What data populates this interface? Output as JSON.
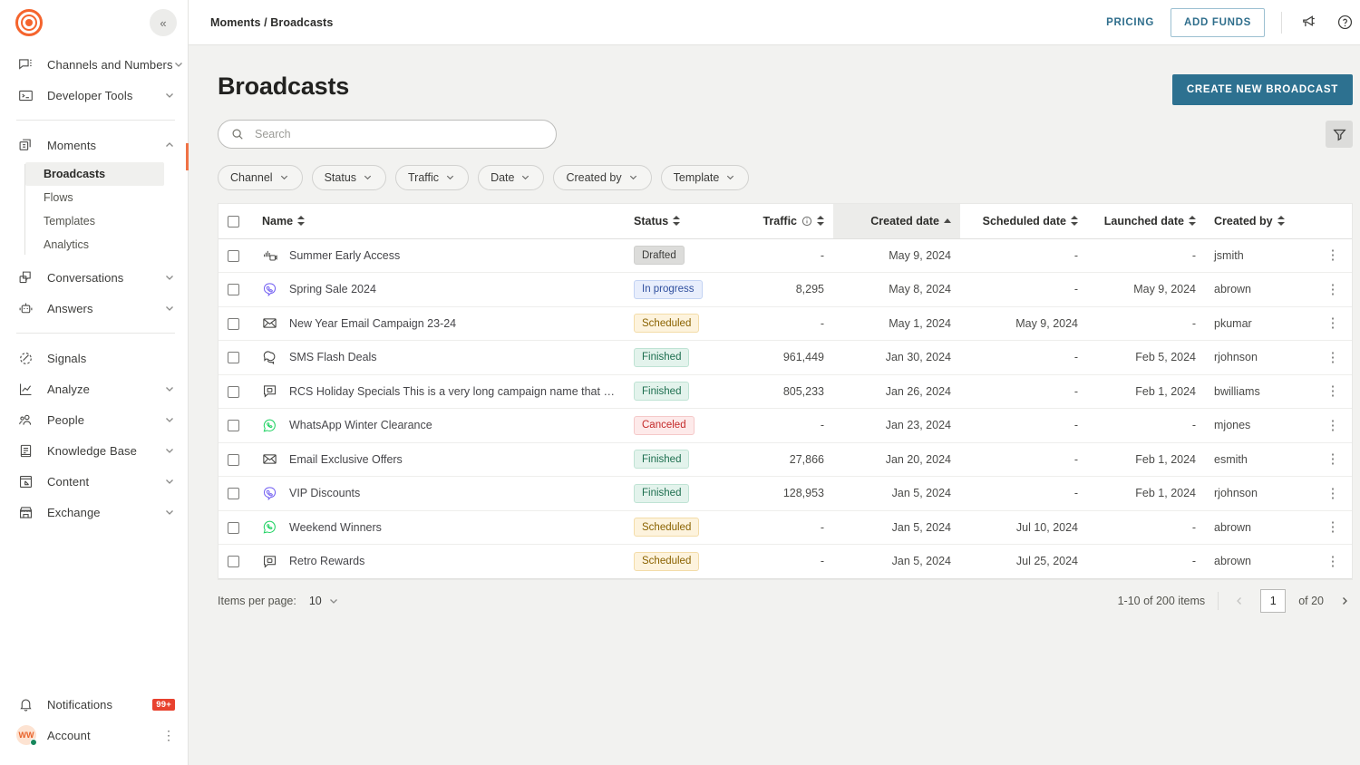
{
  "sidebar": {
    "logo_name": "infobip-logo-icon",
    "collapse_label": "«",
    "groups": [
      {
        "items": [
          {
            "label": "Channels and Numbers",
            "icon": "chat-numbers-icon",
            "expandable": true
          },
          {
            "label": "Developer Tools",
            "icon": "terminal-icon",
            "expandable": true
          }
        ]
      },
      {
        "items": [
          {
            "label": "Moments",
            "icon": "moments-icon",
            "expandable": true,
            "expanded": true,
            "children": [
              {
                "label": "Broadcasts",
                "active": true
              },
              {
                "label": "Flows",
                "active": false
              },
              {
                "label": "Templates",
                "active": false
              },
              {
                "label": "Analytics",
                "active": false
              }
            ]
          },
          {
            "label": "Conversations",
            "icon": "conversations-icon",
            "expandable": true
          },
          {
            "label": "Answers",
            "icon": "answers-bot-icon",
            "expandable": true
          }
        ]
      },
      {
        "items": [
          {
            "label": "Signals",
            "icon": "signals-icon",
            "expandable": false
          },
          {
            "label": "Analyze",
            "icon": "analyze-chart-icon",
            "expandable": true
          },
          {
            "label": "People",
            "icon": "people-icon",
            "expandable": true
          },
          {
            "label": "Knowledge Base",
            "icon": "knowledge-base-icon",
            "expandable": true
          },
          {
            "label": "Content",
            "icon": "content-icon",
            "expandable": true
          },
          {
            "label": "Exchange",
            "icon": "exchange-store-icon",
            "expandable": true
          }
        ]
      }
    ],
    "notifications": {
      "label": "Notifications",
      "badge": "99+",
      "icon": "bell-icon"
    },
    "account": {
      "label": "Account",
      "initials": "WW",
      "status": "online"
    }
  },
  "topbar": {
    "breadcrumb": "Moments / Broadcasts",
    "pricing_label": "PRICING",
    "add_funds_label": "ADD FUNDS",
    "announcements_icon": "megaphone-icon",
    "help_icon": "help-circle-icon"
  },
  "page": {
    "title": "Broadcasts",
    "create_button_label": "CREATE NEW BROADCAST"
  },
  "search": {
    "placeholder": "Search",
    "value": "",
    "icon": "search-icon"
  },
  "filter_button": {
    "icon": "funnel-filter-icon"
  },
  "filters": [
    {
      "label": "Channel"
    },
    {
      "label": "Status"
    },
    {
      "label": "Traffic"
    },
    {
      "label": "Date"
    },
    {
      "label": "Created by"
    },
    {
      "label": "Template"
    }
  ],
  "table": {
    "columns": [
      {
        "key": "name",
        "label": "Name",
        "sortable": true,
        "sorted": "none",
        "align": "left"
      },
      {
        "key": "status",
        "label": "Status",
        "sortable": true,
        "sorted": "none",
        "align": "left"
      },
      {
        "key": "traffic",
        "label": "Traffic",
        "sortable": true,
        "sorted": "none",
        "align": "right",
        "info": true
      },
      {
        "key": "created_date",
        "label": "Created date",
        "sortable": true,
        "sorted": "asc",
        "align": "right"
      },
      {
        "key": "scheduled_date",
        "label": "Scheduled date",
        "sortable": true,
        "sorted": "none",
        "align": "right"
      },
      {
        "key": "launched_date",
        "label": "Launched date",
        "sortable": true,
        "sorted": "none",
        "align": "right"
      },
      {
        "key": "created_by",
        "label": "Created by",
        "sortable": true,
        "sorted": "none",
        "align": "left"
      }
    ],
    "rows": [
      {
        "name": "Summer Early Access",
        "icon": "broadcast-multichannel-icon",
        "status": "Drafted",
        "status_kind": "drafted",
        "traffic": "-",
        "created_date": "May 9, 2024",
        "scheduled_date": "-",
        "launched_date": "-",
        "created_by": "jsmith"
      },
      {
        "name": "Spring Sale 2024",
        "icon": "viber-icon",
        "status": "In progress",
        "status_kind": "inprogress",
        "traffic": "8,295",
        "created_date": "May 8, 2024",
        "scheduled_date": "-",
        "launched_date": "May 9, 2024",
        "created_by": "abrown"
      },
      {
        "name": "New Year Email Campaign 23-24",
        "icon": "email-icon",
        "status": "Scheduled",
        "status_kind": "scheduled",
        "traffic": "-",
        "created_date": "May 1, 2024",
        "scheduled_date": "May 9, 2024",
        "launched_date": "-",
        "created_by": "pkumar"
      },
      {
        "name": "SMS Flash Deals",
        "icon": "sms-icon",
        "status": "Finished",
        "status_kind": "finished",
        "traffic": "961,449",
        "created_date": "Jan 30, 2024",
        "scheduled_date": "-",
        "launched_date": "Feb 5, 2024",
        "created_by": "rjohnson"
      },
      {
        "name": "RCS Holiday Specials This is a very long campaign name that wont fit into...",
        "icon": "rcs-icon",
        "status": "Finished",
        "status_kind": "finished",
        "traffic": "805,233",
        "created_date": "Jan 26, 2024",
        "scheduled_date": "-",
        "launched_date": "Feb 1, 2024",
        "created_by": "bwilliams"
      },
      {
        "name": "WhatsApp Winter Clearance",
        "icon": "whatsapp-icon",
        "status": "Canceled",
        "status_kind": "canceled",
        "traffic": "-",
        "created_date": "Jan 23, 2024",
        "scheduled_date": "-",
        "launched_date": "-",
        "created_by": "mjones"
      },
      {
        "name": "Email Exclusive Offers",
        "icon": "email-icon",
        "status": "Finished",
        "status_kind": "finished",
        "traffic": "27,866",
        "created_date": "Jan 20, 2024",
        "scheduled_date": "-",
        "launched_date": "Feb 1, 2024",
        "created_by": "esmith"
      },
      {
        "name": "VIP Discounts",
        "icon": "viber-icon",
        "status": "Finished",
        "status_kind": "finished",
        "traffic": "128,953",
        "created_date": "Jan 5, 2024",
        "scheduled_date": "-",
        "launched_date": "Feb 1, 2024",
        "created_by": "rjohnson"
      },
      {
        "name": "Weekend Winners",
        "icon": "whatsapp-icon",
        "status": "Scheduled",
        "status_kind": "scheduled",
        "traffic": "-",
        "created_date": "Jan 5, 2024",
        "scheduled_date": "Jul 10, 2024",
        "launched_date": "-",
        "created_by": "abrown"
      },
      {
        "name": "Retro Rewards",
        "icon": "rcs-icon",
        "status": "Scheduled",
        "status_kind": "scheduled",
        "traffic": "-",
        "created_date": "Jan 5, 2024",
        "scheduled_date": "Jul 25, 2024",
        "launched_date": "-",
        "created_by": "abrown"
      }
    ]
  },
  "footer": {
    "items_per_page_label": "Items per page:",
    "items_per_page_value": "10",
    "range_label": "1-10 of 200 items",
    "page_value": "1",
    "of_label": "of 20"
  },
  "colors": {
    "brand_orange": "#f5642d",
    "accent_blue": "#2d7190",
    "link_blue": "#2f6e8c",
    "badge_red": "#e8412e",
    "online_green": "#17875c",
    "whatsapp_green": "#25d366",
    "viber_purple": "#7360f2",
    "page_bg": "#f2f2f0"
  }
}
